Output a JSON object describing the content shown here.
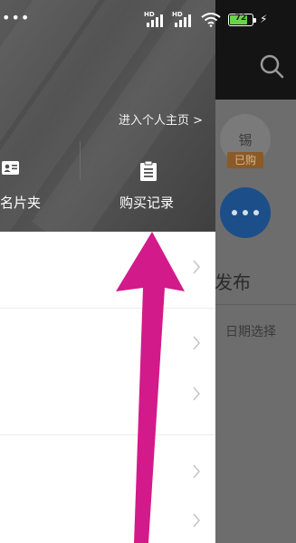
{
  "status_bar": {
    "network_left": "HD",
    "network_right": "HD",
    "battery_level": "72",
    "battery_fraction": 0.72
  },
  "drawer": {
    "profile_link": "进入个人主页 >",
    "shortcuts": [
      {
        "label": "名片夹",
        "icon": "card-icon"
      },
      {
        "label": "购买记录",
        "icon": "clipboard-icon"
      }
    ],
    "menu_rows": 5
  },
  "background_page": {
    "avatar_text": "锡",
    "badge": "已购",
    "tab_label": "发布",
    "date_selector": "日期选择"
  },
  "colors": {
    "drawer_header": "#4d4d4d",
    "arrow": "#d31a8a",
    "badge": "#8a5a28",
    "more_button": "#1c4f8a",
    "battery_fill": "#6cd248"
  }
}
